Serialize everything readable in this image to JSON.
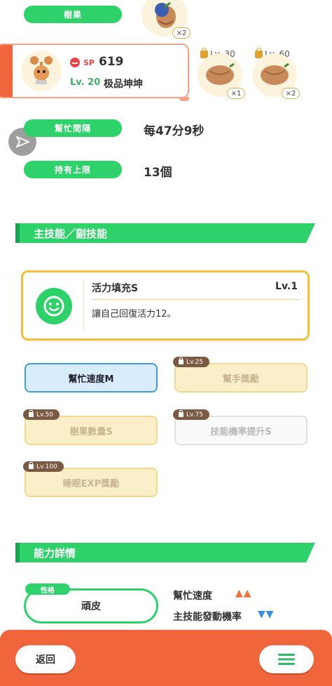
{
  "top": {
    "berries_label": "樹果",
    "top_berry_count": "×2"
  },
  "pokemon_card": {
    "sp_label": "SP",
    "sp_value": "619",
    "level": "Lv. 20",
    "name": "极品坤坤"
  },
  "berry_slots": [
    {
      "level": "Lv. 30",
      "count": "×1"
    },
    {
      "level": "Lv. 60",
      "count": "×2"
    }
  ],
  "stats": {
    "help_interval_label": "幫忙間隔",
    "help_interval_value": "每47分9秒",
    "carry_limit_label": "持有上限",
    "carry_limit_value": "13個"
  },
  "skills_section": {
    "title": "主技能／副技能",
    "main_skill": {
      "name": "活力填充S",
      "level": "Lv.1",
      "description": "讓自己回復活力12。"
    },
    "sub_skills": [
      {
        "name": "幫忙速度M",
        "lock": ""
      },
      {
        "name": "幫手獎勵",
        "lock": "Lv.25"
      },
      {
        "name": "樹果數量S",
        "lock": "Lv.50"
      },
      {
        "name": "技能機率提升S",
        "lock": "Lv.75"
      },
      {
        "name": "睡眠EXP獎勵",
        "lock": "Lv.100"
      }
    ]
  },
  "ability_section": {
    "title": "能力詳情",
    "nature_tag": "性格",
    "nature_value": "頑皮",
    "effects": [
      {
        "label": "幫忙速度",
        "indicator": "▲▲",
        "color": "#f0713b"
      },
      {
        "label": "主技能發動機率",
        "indicator": "▼▼",
        "color": "#3d8de0"
      }
    ]
  },
  "bottom_bar": {
    "back_label": "返回",
    "bar_color": "#f0653c"
  }
}
